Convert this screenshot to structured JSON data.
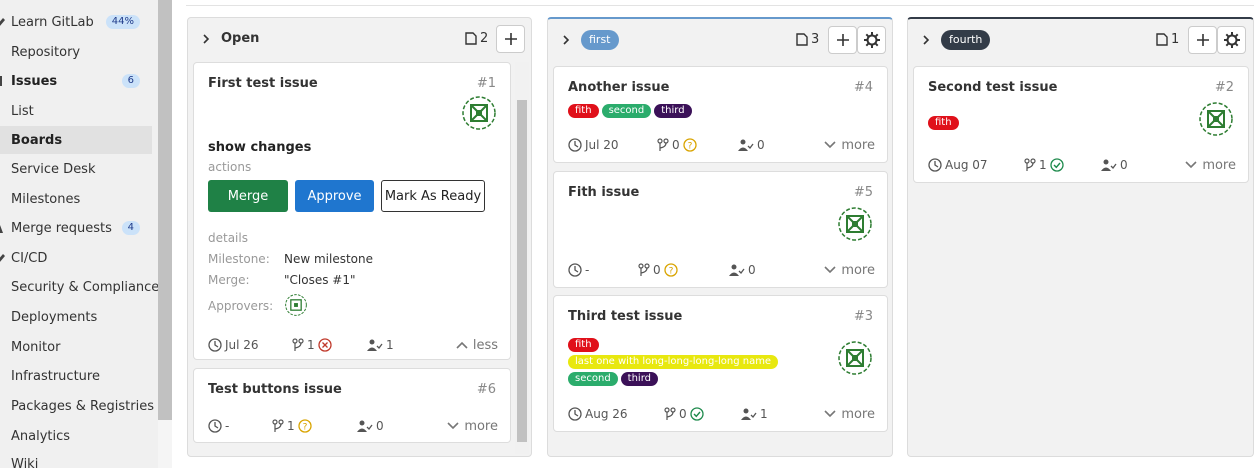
{
  "sidebar": {
    "items": [
      {
        "label": "Learn GitLab",
        "badge": "44%"
      },
      {
        "label": "Repository"
      },
      {
        "label": "Issues",
        "badge": "6"
      },
      {
        "label": "List"
      },
      {
        "label": "Boards"
      },
      {
        "label": "Service Desk"
      },
      {
        "label": "Milestones"
      },
      {
        "label": "Merge requests",
        "badge": "4"
      },
      {
        "label": "CI/CD"
      },
      {
        "label": "Security & Compliance"
      },
      {
        "label": "Deployments"
      },
      {
        "label": "Monitor"
      },
      {
        "label": "Infrastructure"
      },
      {
        "label": "Packages & Registries"
      },
      {
        "label": "Analytics"
      },
      {
        "label": "Wiki"
      }
    ]
  },
  "colors": {
    "label_fith": "#e0101a",
    "label_second": "#2bac6c",
    "label_third": "#3b1158",
    "label_long": "#e8e80f",
    "label_first": "#6699cc",
    "label_fourth": "#333c48",
    "merge_btn": "#1f8146",
    "approve_btn": "#1f76cf"
  },
  "board": {
    "columns": [
      {
        "title": "Open",
        "count": "2",
        "cards": [
          {
            "title": "First test issue",
            "ref": "#1",
            "avatar": "identicon",
            "section_title": "show changes",
            "section_sub": "actions",
            "buttons": {
              "merge": "Merge",
              "approve": "Approve",
              "ready": "Mark As Ready"
            },
            "details_label": "details",
            "details": [
              {
                "key": "Milestone:",
                "value": "New milestone"
              },
              {
                "key": "Merge:",
                "value": "\"Closes #1\""
              },
              {
                "key": "Approvers:",
                "value": ""
              }
            ],
            "date": "Jul 26",
            "mr_count": "1",
            "mr_status_icon": "failed-icon",
            "assignees": "1",
            "toggle": "less"
          },
          {
            "title": "Test buttons issue",
            "ref": "#6",
            "date": "-",
            "mr_count": "1",
            "mr_status_icon": "unknown-icon",
            "assignees": "0",
            "toggle": "more"
          }
        ]
      },
      {
        "title": "first",
        "count": "3",
        "cards": [
          {
            "title": "Another issue",
            "ref": "#4",
            "labels": [
              "fith",
              "second",
              "third"
            ],
            "date": "Jul 20",
            "mr_count": "0",
            "mr_status_icon": "unknown-icon",
            "assignees": "0",
            "toggle": "more"
          },
          {
            "title": "Fith issue",
            "ref": "#5",
            "avatar": "identicon",
            "date": "-",
            "mr_count": "0",
            "mr_status_icon": "unknown-icon",
            "assignees": "0",
            "toggle": "more"
          },
          {
            "title": "Third test issue",
            "ref": "#3",
            "avatar": "identicon",
            "labels": [
              "fith",
              "last one with long-long-long-long name",
              "second",
              "third"
            ],
            "date": "Aug 26",
            "mr_count": "0",
            "mr_status_icon": "passed-icon",
            "assignees": "1",
            "toggle": "more"
          }
        ]
      },
      {
        "title": "fourth",
        "count": "1",
        "cards": [
          {
            "title": "Second test issue",
            "ref": "#2",
            "avatar": "identicon",
            "labels": [
              "fith"
            ],
            "date": "Aug 07",
            "mr_count": "1",
            "mr_status_icon": "passed-icon",
            "assignees": "0",
            "toggle": "more"
          }
        ]
      }
    ]
  }
}
